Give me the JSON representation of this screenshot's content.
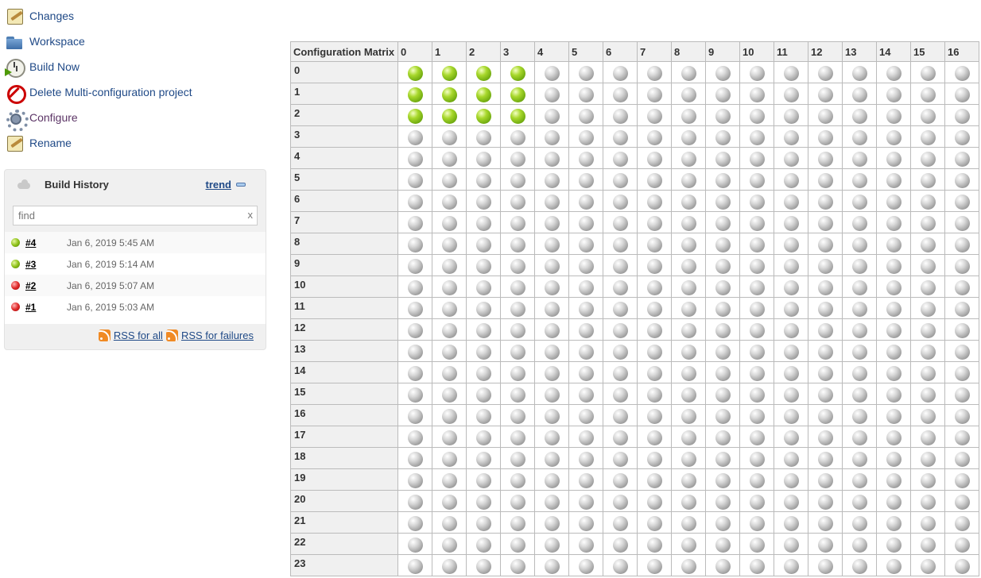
{
  "side_panel": {
    "tasks": [
      {
        "label": "Changes",
        "icon": "notepad-icon",
        "visited": false
      },
      {
        "label": "Workspace",
        "icon": "folder-icon",
        "visited": false
      },
      {
        "label": "Build Now",
        "icon": "clock-icon",
        "visited": false
      },
      {
        "label": "Delete Multi-configuration project",
        "icon": "no-entry-icon",
        "visited": false
      },
      {
        "label": "Configure",
        "icon": "gear-icon",
        "visited": true
      },
      {
        "label": "Rename",
        "icon": "notepad-icon",
        "visited": false
      }
    ]
  },
  "build_history": {
    "title": "Build History",
    "trend_label": "trend",
    "search_placeholder": "find",
    "clear_label": "x",
    "builds": [
      {
        "number": "#4",
        "date": "Jan 6, 2019 5:45 AM",
        "status": "success"
      },
      {
        "number": "#3",
        "date": "Jan 6, 2019 5:14 AM",
        "status": "success"
      },
      {
        "number": "#2",
        "date": "Jan 6, 2019 5:07 AM",
        "status": "failure"
      },
      {
        "number": "#1",
        "date": "Jan 6, 2019 5:03 AM",
        "status": "failure"
      }
    ],
    "rss_all_label": "RSS for all",
    "rss_failures_label": "RSS for failures"
  },
  "matrix": {
    "corner_label": "Configuration Matrix",
    "columns": [
      "0",
      "1",
      "2",
      "3",
      "4",
      "5",
      "6",
      "7",
      "8",
      "9",
      "10",
      "11",
      "12",
      "13",
      "14",
      "15",
      "16"
    ],
    "rows": [
      "0",
      "1",
      "2",
      "3",
      "4",
      "5",
      "6",
      "7",
      "8",
      "9",
      "10",
      "11",
      "12",
      "13",
      "14",
      "15",
      "16",
      "17",
      "18",
      "19",
      "20",
      "21",
      "22",
      "23"
    ],
    "status_grid": [
      [
        "blue",
        "blue",
        "blue",
        "blue",
        "grey",
        "grey",
        "grey",
        "grey",
        "grey",
        "grey",
        "grey",
        "grey",
        "grey",
        "grey",
        "grey",
        "grey",
        "grey"
      ],
      [
        "blue",
        "blue",
        "blue",
        "blue",
        "grey",
        "grey",
        "grey",
        "grey",
        "grey",
        "grey",
        "grey",
        "grey",
        "grey",
        "grey",
        "grey",
        "grey",
        "grey"
      ],
      [
        "blue",
        "blue",
        "blue",
        "blue",
        "grey",
        "grey",
        "grey",
        "grey",
        "grey",
        "grey",
        "grey",
        "grey",
        "grey",
        "grey",
        "grey",
        "grey",
        "grey"
      ]
    ],
    "default_status": "grey"
  },
  "colors": {
    "link": "#204a87",
    "visited_link": "#5c3566",
    "success_ball": "#8fc21a",
    "failure_ball": "#e02a2a",
    "disabled_ball": "#9c9c9c"
  }
}
